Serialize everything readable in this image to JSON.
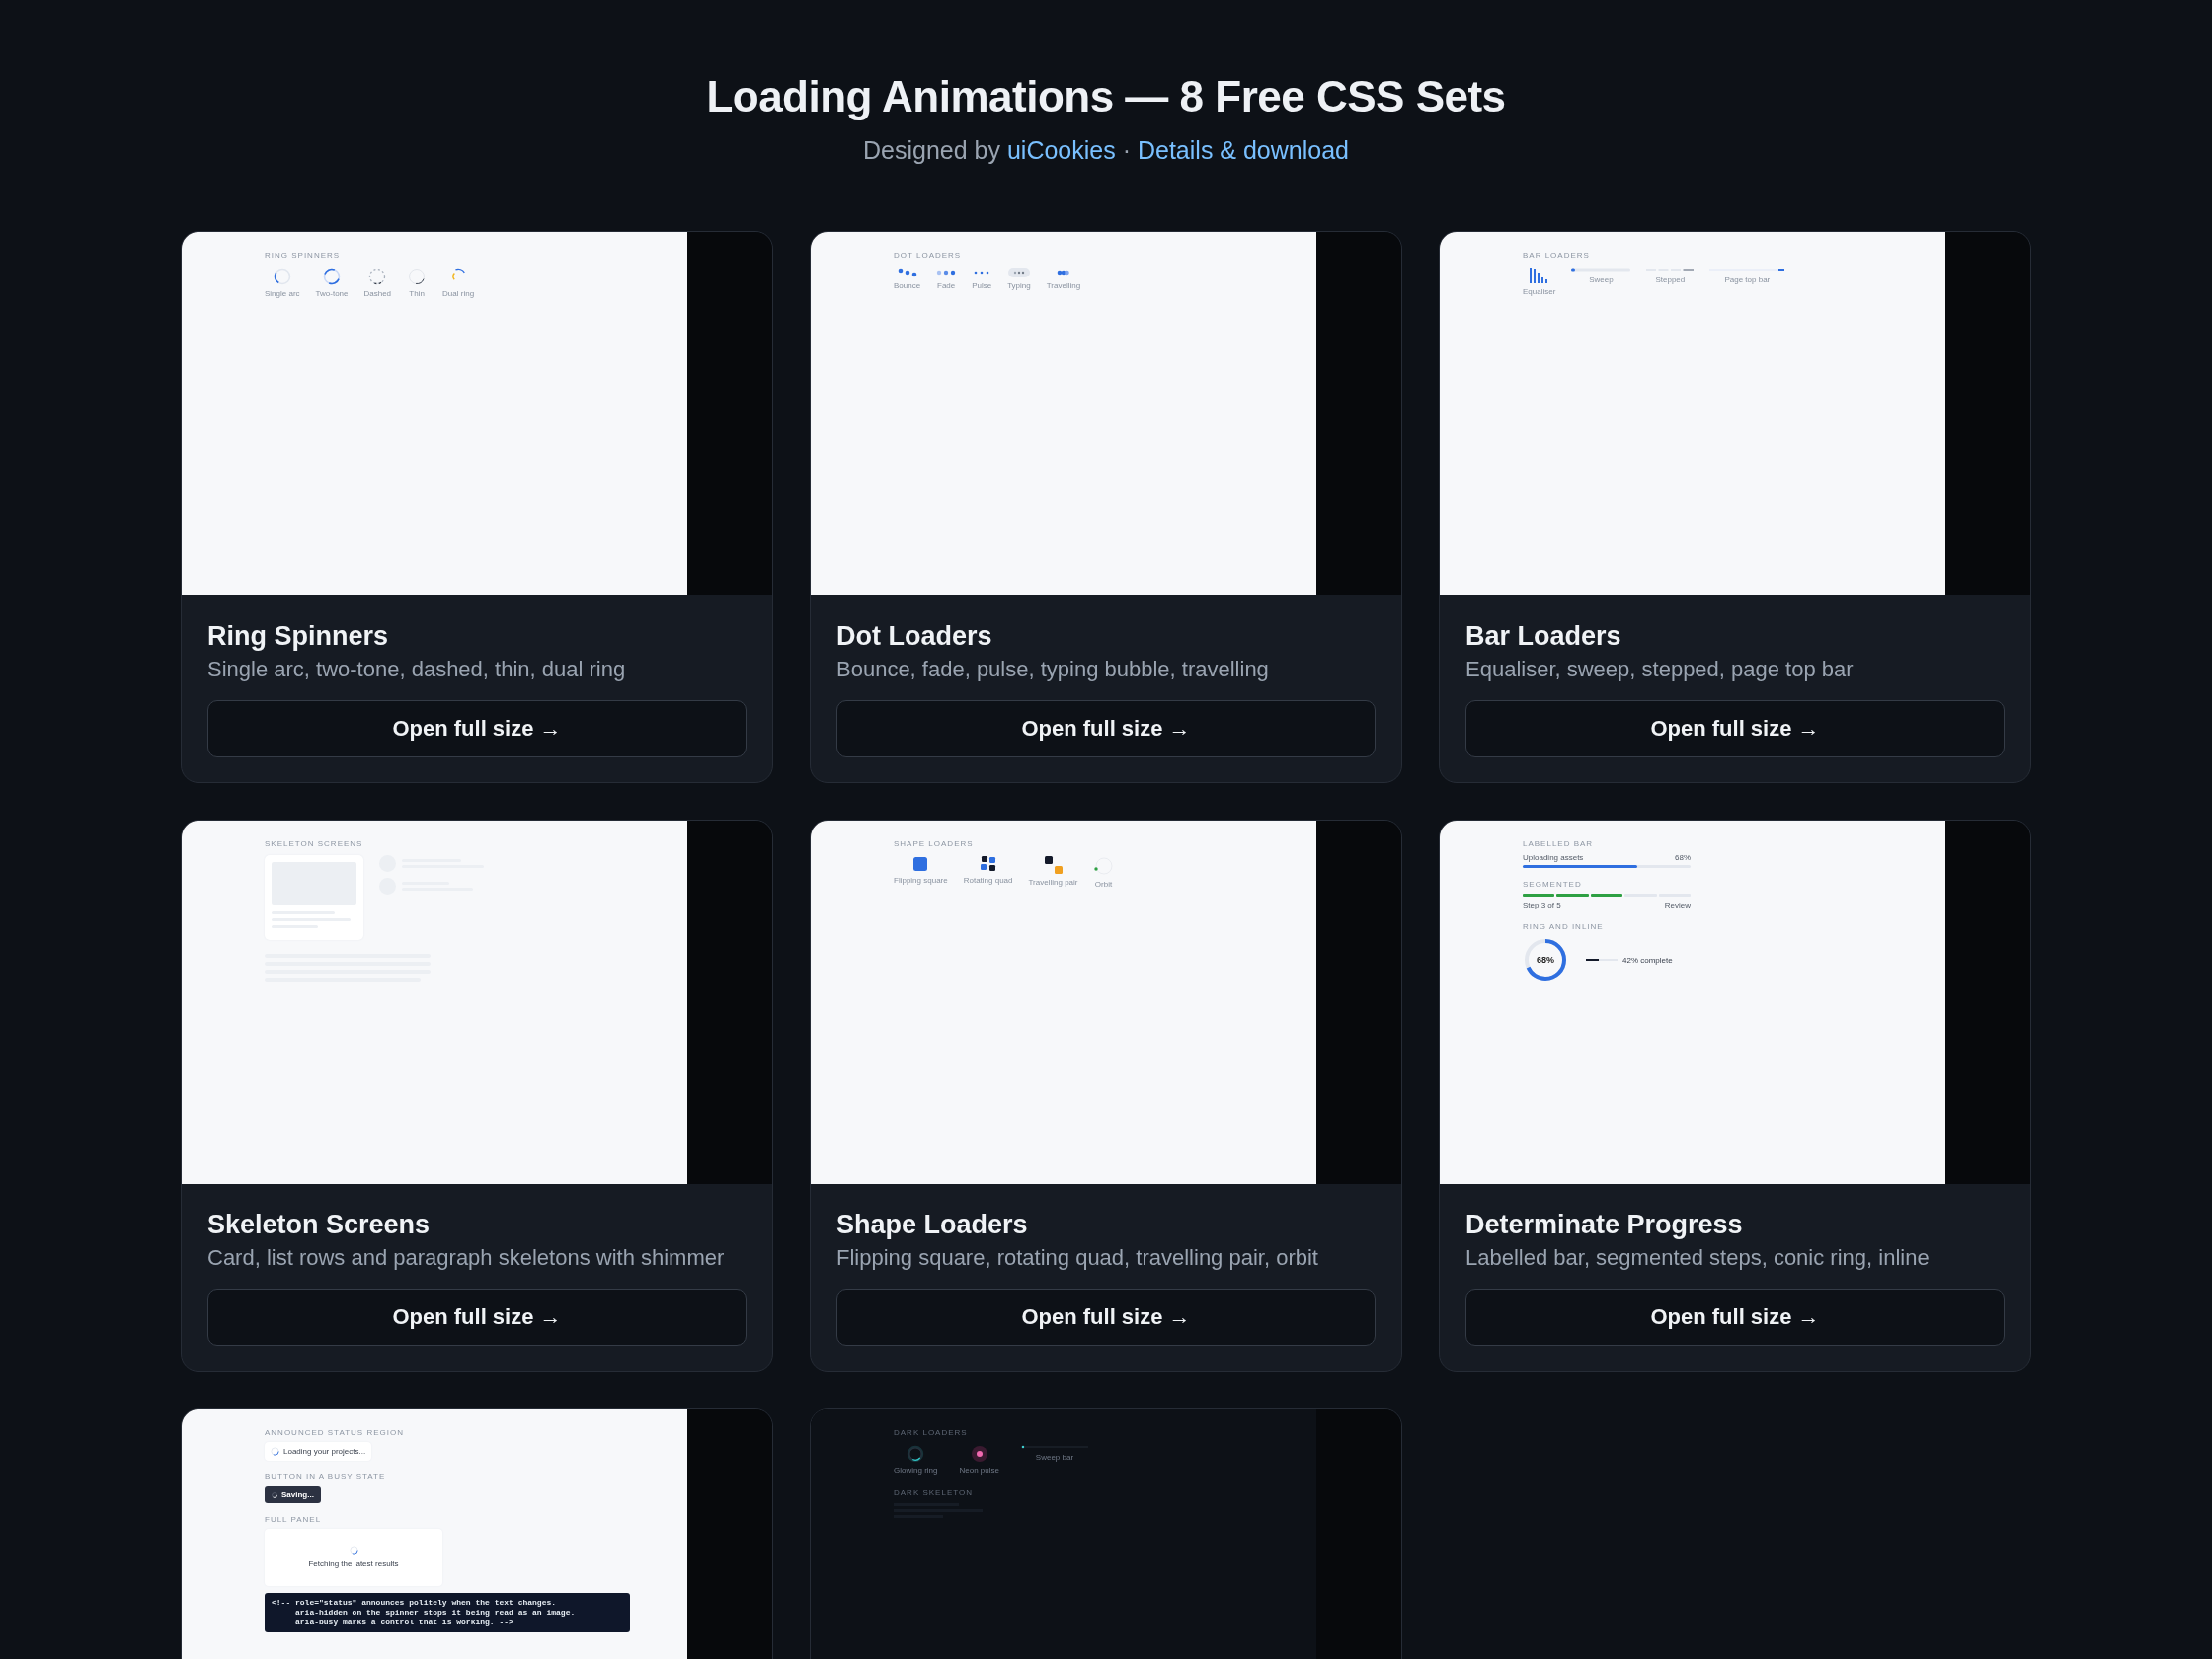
{
  "header": {
    "title": "Loading Animations — 8 Free CSS Sets",
    "subtitle": {
      "prefix": "Designed by",
      "designer": "uiCookies",
      "separator": "·",
      "link": "Details & download"
    }
  },
  "cards": [
    {
      "title": "Ring Spinners",
      "description": "Single arc, two-tone, dashed, thin, dual ring",
      "button": "Open full size →",
      "preview": {
        "kind": "loaders",
        "heading": "RING SPINNERS",
        "items": [
          {
            "label": "Single arc",
            "kind": "single"
          },
          {
            "label": "Two-tone",
            "kind": "two-tone"
          },
          {
            "label": "Dashed",
            "kind": "dashed"
          },
          {
            "label": "Thin",
            "kind": "thin"
          },
          {
            "label": "Dual ring",
            "kind": "dual"
          }
        ]
      }
    },
    {
      "title": "Dot Loaders",
      "description": "Bounce, fade, pulse, typing bubble, travelling",
      "button": "Open full size →",
      "preview": {
        "kind": "loaders",
        "heading": "DOT LOADERS",
        "items": [
          {
            "label": "Bounce",
            "kind": "bounce"
          },
          {
            "label": "Fade",
            "kind": "fade"
          },
          {
            "label": "Pulse",
            "kind": "pulse"
          },
          {
            "label": "Typing",
            "kind": "typing"
          },
          {
            "label": "Travelling",
            "kind": "travelling"
          }
        ]
      }
    },
    {
      "title": "Bar Loaders",
      "description": "Equaliser, sweep, stepped, page top bar",
      "button": "Open full size →",
      "preview": {
        "kind": "loaders",
        "heading": "BAR LOADERS",
        "items": [
          {
            "label": "Equaliser",
            "kind": "equaliser"
          },
          {
            "label": "Sweep",
            "kind": "sweep"
          },
          {
            "label": "Stepped",
            "kind": "stepped"
          },
          {
            "label": "Page top bar",
            "kind": "topbar"
          }
        ]
      }
    },
    {
      "title": "Skeleton Screens",
      "description": "Card, list rows and paragraph skeletons with shimmer",
      "button": "Open full size →",
      "preview": {
        "kind": "skeleton",
        "heading": "SKELETON SCREENS"
      }
    },
    {
      "title": "Shape Loaders",
      "description": "Flipping square, rotating quad, travelling pair, orbit",
      "button": "Open full size →",
      "preview": {
        "kind": "loaders",
        "heading": "SHAPE LOADERS",
        "items": [
          {
            "label": "Flipping square",
            "kind": "square"
          },
          {
            "label": "Rotating quad",
            "kind": "quad"
          },
          {
            "label": "Travelling pair",
            "kind": "pair"
          },
          {
            "label": "Orbit",
            "kind": "orbit"
          }
        ]
      }
    },
    {
      "title": "Determinate Progress",
      "description": "Labelled bar, segmented steps, conic ring, inline",
      "button": "Open full size →",
      "preview": {
        "kind": "progress",
        "bar": {
          "heading": "LABELLED BAR",
          "label": "Uploading assets",
          "reading": "68%",
          "level": 0.68
        },
        "segmented": {
          "heading": "SEGMENTED",
          "segments": [
            {
              "done": true
            },
            {
              "done": true
            },
            {
              "done": true
            },
            {
              "done": false
            },
            {
              "done": false
            }
          ],
          "step": "Step 3 of 5",
          "end": "Review"
        },
        "ring": {
          "heading": "RING AND INLINE",
          "reading": "68%",
          "level": 0.68
        },
        "inline": {
          "level": 0.42,
          "reading": "42% complete"
        }
      }
    },
    {
      "preview": {
        "kind": "status",
        "status_heading": "ANNOUNCED STATUS REGION",
        "status_text": "Loading your projects...",
        "button_heading": "BUTTON IN A BUSY STATE",
        "button_text": "Saving...",
        "panel_heading": "FULL PANEL",
        "panel_text": "Fetching the latest results",
        "code": [
          "<!-- role=\"status\" announces politely when the text changes.",
          "     aria-hidden on the spinner stops it being read as an image.",
          "     aria-busy marks a control that is working. -->"
        ]
      }
    },
    {
      "preview": {
        "kind": "dark",
        "heading": "DARK LOADERS",
        "items": [
          {
            "label": "Glowing ring",
            "kind": "glow"
          },
          {
            "label": "Neon pulse",
            "kind": "neon"
          },
          {
            "label": "Sweep bar",
            "kind": "darksweep"
          }
        ],
        "skeleton_heading": "DARK SKELETON"
      }
    }
  ]
}
